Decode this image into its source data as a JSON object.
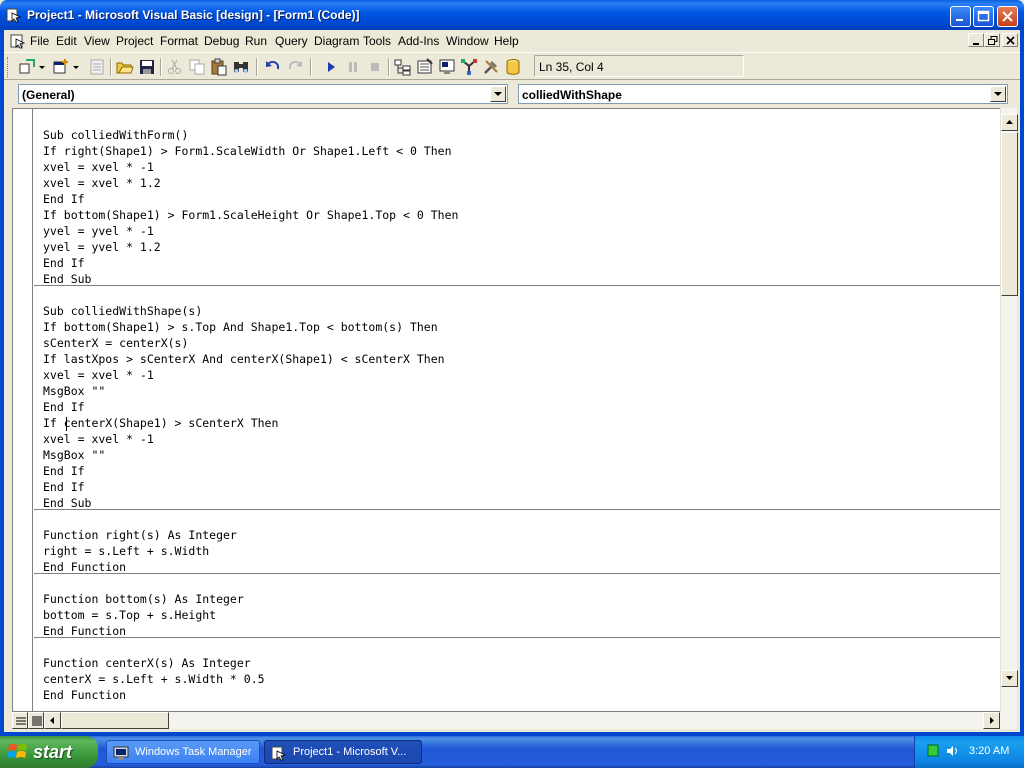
{
  "window": {
    "title": "Project1 - Microsoft Visual Basic [design] - [Form1 (Code)]"
  },
  "menu": [
    "File",
    "Edit",
    "View",
    "Project",
    "Format",
    "Debug",
    "Run",
    "Query",
    "Diagram",
    "Tools",
    "Add-Ins",
    "Window",
    "Help"
  ],
  "toolbar": {
    "status": "Ln 35, Col 4"
  },
  "combos": {
    "object": "(General)",
    "procedure": "colliedWithShape"
  },
  "code_blocks": [
    {
      "lines": [
        "Sub colliedWithForm()",
        "If right(Shape1) > Form1.ScaleWidth Or Shape1.Left < 0 Then",
        "xvel = xvel * -1",
        "xvel = xvel * 1.2",
        "End If",
        "If bottom(Shape1) > Form1.ScaleHeight Or Shape1.Top < 0 Then",
        "yvel = yvel * -1",
        "yvel = yvel * 1.2",
        "End If",
        "End Sub"
      ]
    },
    {
      "lines": [
        "Sub colliedWithShape(s)",
        "If bottom(Shape1) > s.Top And Shape1.Top < bottom(s) Then",
        "sCenterX = centerX(s)",
        "If lastXpos > sCenterX And centerX(Shape1) < sCenterX Then",
        "xvel = xvel * -1",
        "MsgBox \"\"",
        "End If",
        "If centerX(Shape1) > sCenterX Then",
        "xvel = xvel * -1",
        "MsgBox \"\"",
        "End If",
        "End If",
        "End Sub"
      ]
    },
    {
      "lines": [
        "Function right(s) As Integer",
        "right = s.Left + s.Width",
        "End Function"
      ]
    },
    {
      "lines": [
        "Function bottom(s) As Integer",
        "bottom = s.Top + s.Height",
        "End Function"
      ]
    },
    {
      "lines": [
        "Function centerX(s) As Integer",
        "centerX = s.Left + s.Width * 0.5",
        "End Function"
      ]
    }
  ],
  "taskbar": {
    "start": "start",
    "tasks": [
      "Windows Task Manager",
      "Project1 - Microsoft V..."
    ],
    "clock": "3:20 AM"
  },
  "colors": {
    "titlebar": "#0054e3",
    "taskbar": "#245edb",
    "start": "#3a993a",
    "chrome": "#ece9d8"
  },
  "icons": [
    "vb-app-icon",
    "minimize-icon",
    "maximize-icon",
    "close-icon",
    "add-project-icon",
    "add-form-icon",
    "menu-editor-icon",
    "open-icon",
    "save-icon",
    "cut-icon",
    "copy-icon",
    "paste-icon",
    "find-icon",
    "undo-icon",
    "redo-icon",
    "run-icon",
    "break-icon",
    "stop-icon",
    "project-explorer-icon",
    "properties-icon",
    "form-layout-icon",
    "object-browser-icon",
    "toolbox-icon",
    "data-view-icon",
    "windows-logo-icon",
    "task-manager-icon",
    "network-icon",
    "volume-icon"
  ]
}
